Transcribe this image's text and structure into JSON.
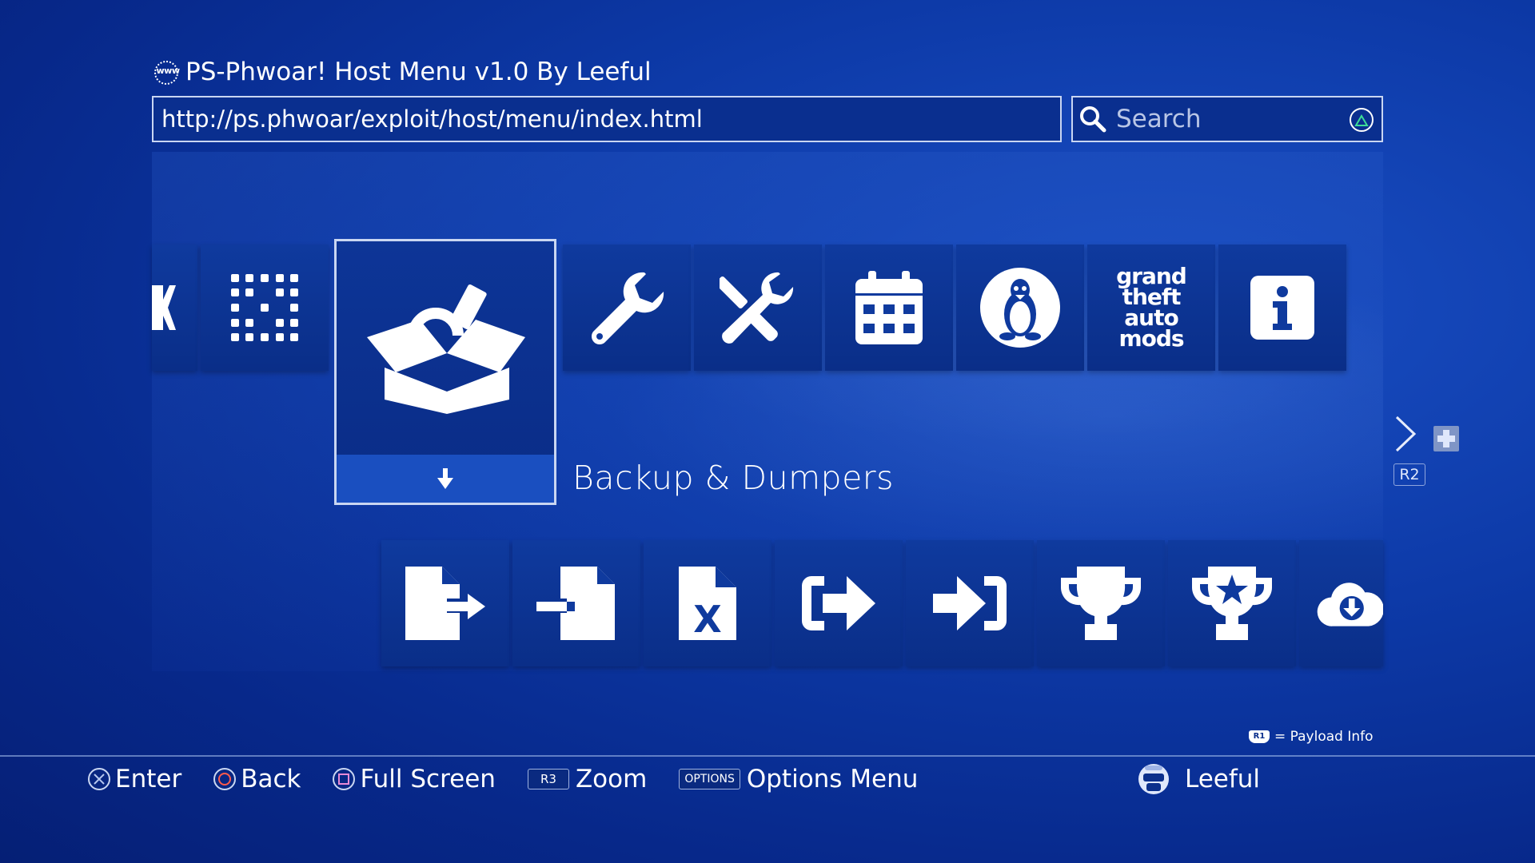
{
  "header": {
    "www_icon_text": "www",
    "title": "PS-Phwoar! Host Menu v1.0 By Leeful",
    "url": "http://ps.phwoar/exploit/host/menu/index.html",
    "search_placeholder": "Search"
  },
  "top_row": {
    "icons": [
      "partial-k-icon",
      "grid-dots-icon",
      "open-box-icon",
      "wrench-icon",
      "tools-icon",
      "calendar-icon",
      "linux-tux-icon",
      "gta-mods-logo",
      "info-icon"
    ],
    "gta_text": [
      "grand",
      "theft",
      "auto",
      "mods"
    ]
  },
  "selected": {
    "label": "Backup & Dumpers",
    "icon": "open-box-icon",
    "expand_icon": "arrow-down-icon"
  },
  "bottom_row": {
    "icons": [
      "file-export-icon",
      "file-import-icon",
      "file-excel-icon",
      "sign-out-icon",
      "sign-in-icon",
      "trophy-icon",
      "trophy-star-icon",
      "cloud-download-icon"
    ],
    "excel_letter": "X"
  },
  "side_nav": {
    "r2_label": "R2"
  },
  "payload_hint": {
    "badge": "R1",
    "text": "= Payload Info"
  },
  "footer": {
    "enter": "Enter",
    "back": "Back",
    "full_screen": "Full Screen",
    "r3_badge": "R3",
    "zoom": "Zoom",
    "options_badge": "OPTIONS",
    "options_menu": "Options Menu",
    "user_name": "Leeful"
  },
  "colors": {
    "background": "#0d3aa8",
    "tile": "#0f3a9e",
    "selected_bar": "#1a4fc0",
    "border": "#c9d6f2"
  }
}
